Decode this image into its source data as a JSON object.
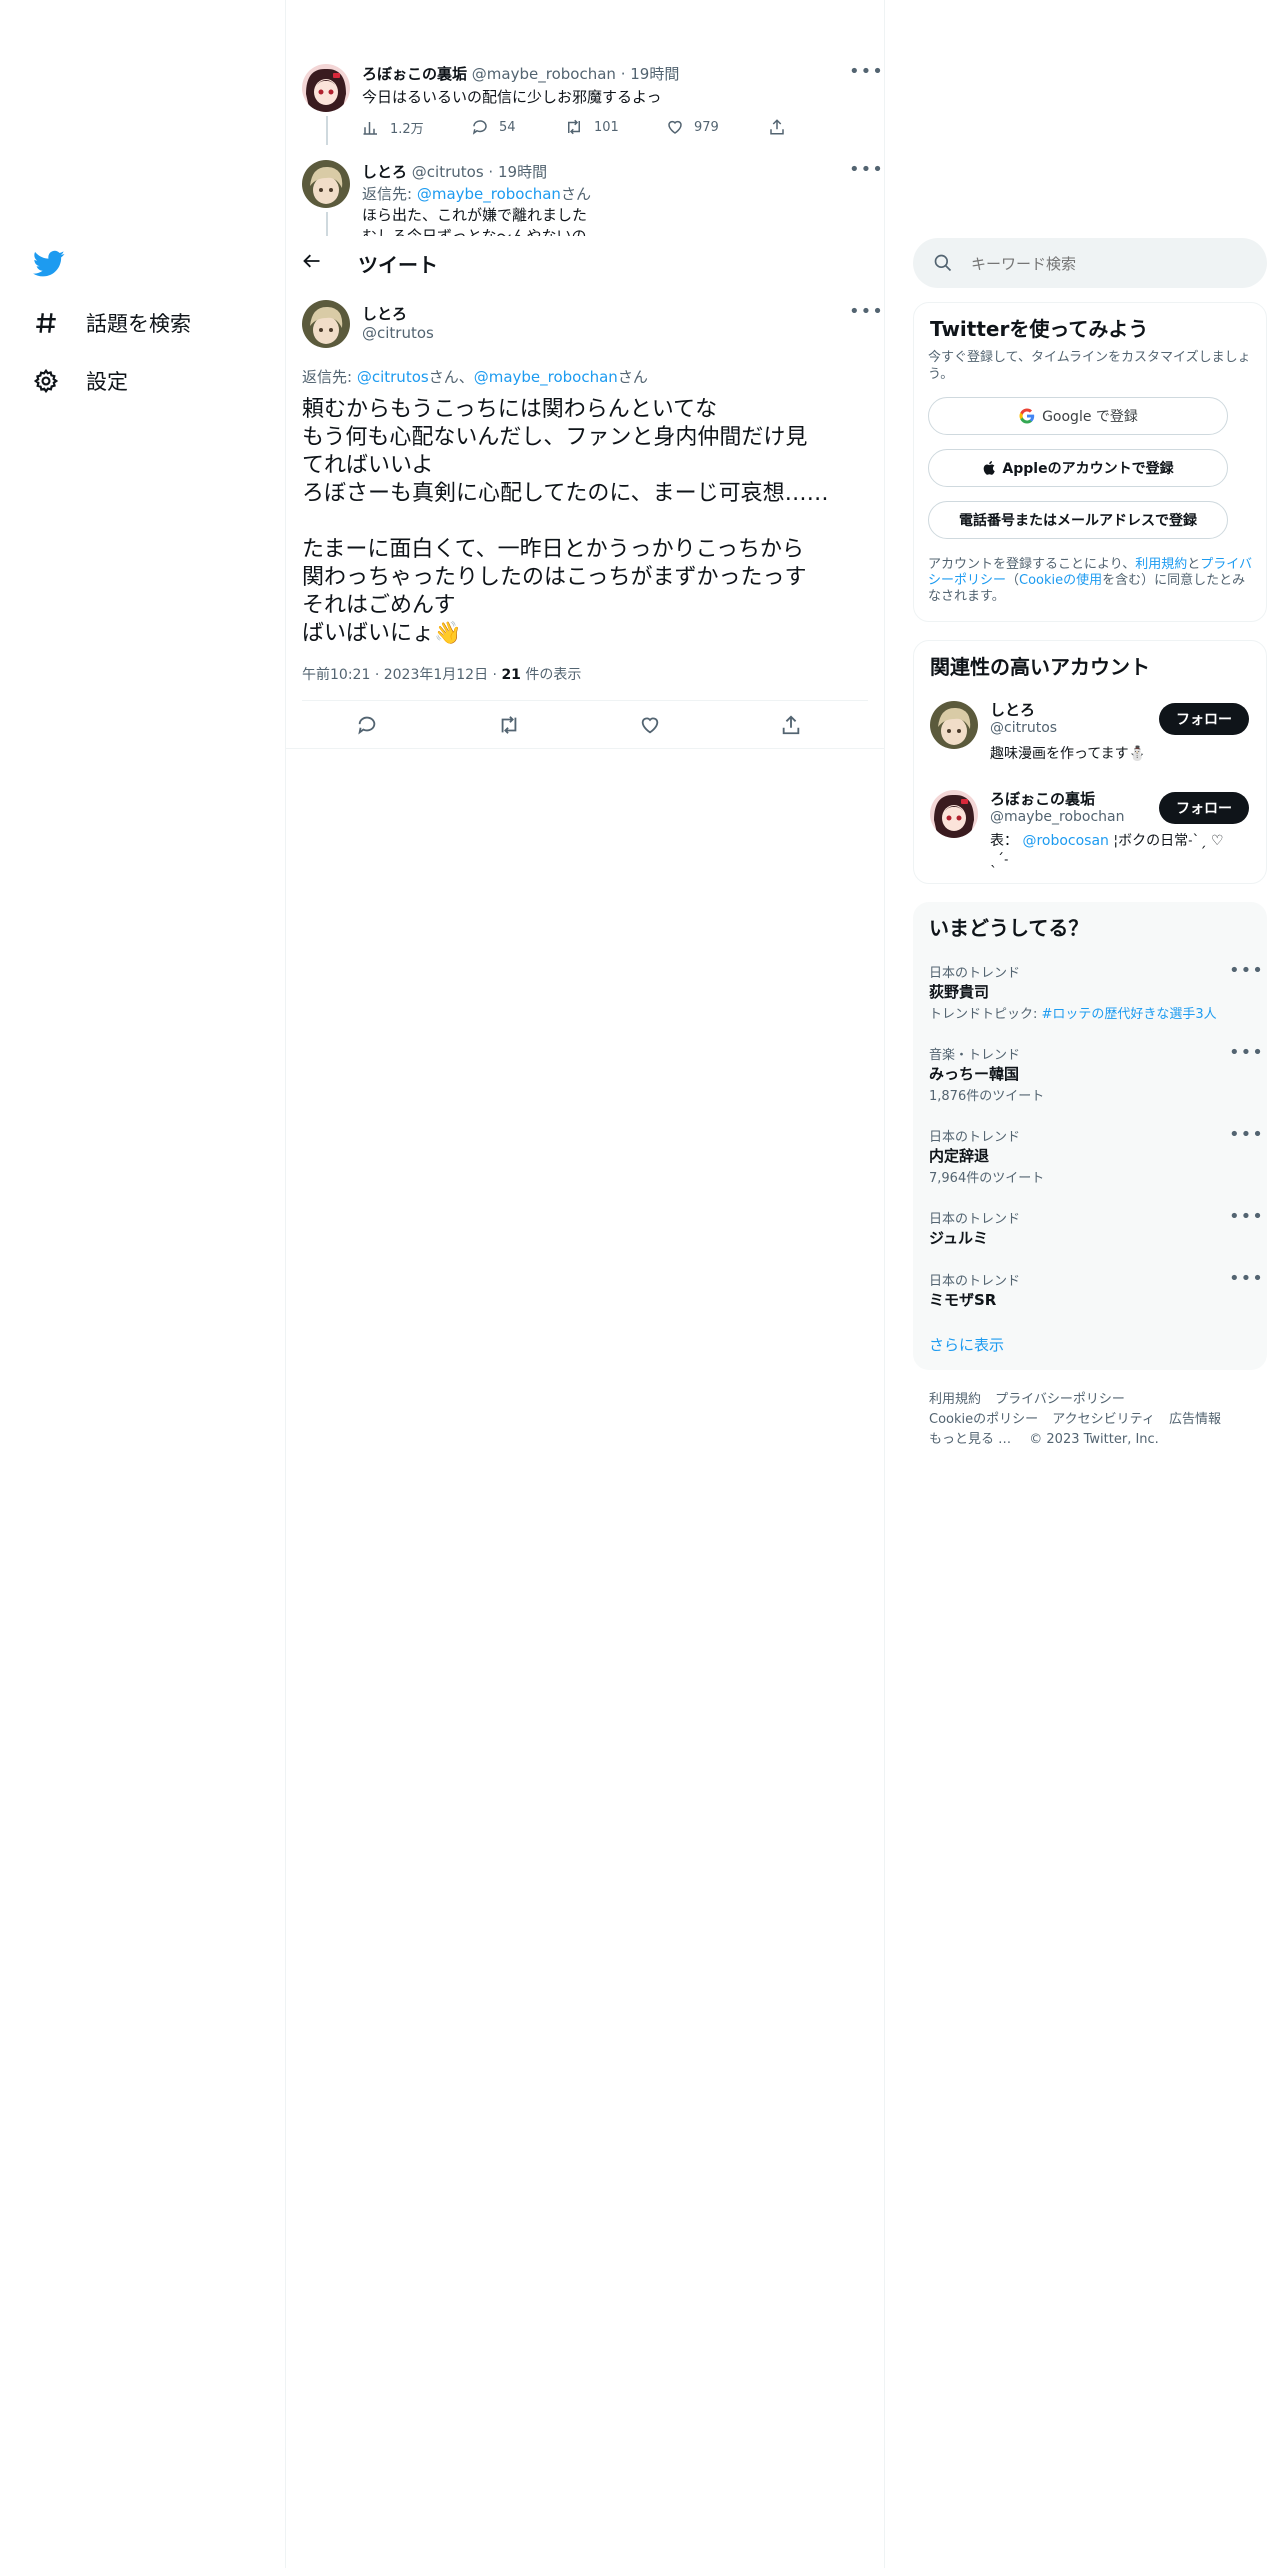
{
  "nav": {
    "items": [
      {
        "label": "話題を検索",
        "icon": "hashtag-icon"
      },
      {
        "label": "設定",
        "icon": "gear-icon"
      }
    ]
  },
  "thread": {
    "tweet1": {
      "name": "ろぼぉこの裏垢",
      "handle": "@maybe_robochan",
      "time": "19時間",
      "text": "今日はるいるいの配信に少しお邪魔するよっ",
      "views": "1.2万",
      "replies": "54",
      "retweets": "101",
      "likes": "979"
    },
    "tweet2": {
      "name": "しとろ",
      "handle": "@citrutos",
      "time": "19時間",
      "reply_prefix": "返信先:",
      "reply_to": "@maybe_robochan",
      "reply_suffix": "さん",
      "text_line1": "ほら出た、これが嫌で離れました",
      "text_line2": "むしろ今日ずっとな〜んやないの"
    }
  },
  "header": {
    "title": "ツイート"
  },
  "main_tweet": {
    "name": "しとろ",
    "handle": "@citrutos",
    "reply_prefix": "返信先:",
    "reply_to1": "@citrutos",
    "reply_mid": "さん、",
    "reply_to2": "@maybe_robochan",
    "reply_suffix": "さん",
    "lines": [
      "頼むからもうこっちには関わらんといてな",
      "もう何も心配ないんだし、ファンと身内仲間だけ見",
      "てればいいよ",
      "ろぼさーも真剣に心配してたのに、まーじ可哀想……",
      "",
      "たまーに面白くて、一昨日とかうっかりこっちから",
      "関わっちゃったりしたのはこっちがまずかったっす",
      "それはごめんす",
      "ばいばいにょ👋"
    ],
    "time": "午前10:21",
    "date": "2023年1月12日",
    "views_count": "21",
    "views_label": "件の表示"
  },
  "search": {
    "placeholder": "キーワード検索"
  },
  "signup": {
    "title": "Twitterを使ってみよう",
    "subtitle": "今すぐ登録して、タイムラインをカスタマイズしましょう。",
    "google": "Google で登録",
    "apple": "Appleのアカウントで登録",
    "phone": "電話番号またはメールアドレスで登録",
    "terms_pre": "アカウントを登録することにより、",
    "terms_link1": "利用規約",
    "terms_and": "と",
    "terms_link2": "プライバシーポリシー",
    "terms_paren1": "（",
    "terms_link3": "Cookieの使用",
    "terms_post": "を含む）に同意したとみなされます。"
  },
  "related": {
    "title": "関連性の高いアカウント",
    "follow_label": "フォロー",
    "accounts": [
      {
        "name": "しとろ",
        "handle": "@citrutos",
        "bio": "趣味漫画を作ってます⛄"
      },
      {
        "name": "ろぼぉこの裏垢",
        "handle": "@maybe_robochan",
        "bio_pre": "表：",
        "bio_link": "@robocosan",
        "bio_post": "¦ボクの日常˗ˋˏ ♡ ˎˊ˗"
      }
    ]
  },
  "trends": {
    "title": "いまどうしてる？",
    "items": [
      {
        "meta": "日本のトレンド",
        "name": "荻野貴司",
        "sub_pre": "トレンドトピック: ",
        "sub_link": "#ロッテの歴代好きな選手3人"
      },
      {
        "meta": "音楽・トレンド",
        "name": "みっちー韓国",
        "sub": "1,876件のツイート"
      },
      {
        "meta": "日本のトレンド",
        "name": "内定辞退",
        "sub": "7,964件のツイート"
      },
      {
        "meta": "日本のトレンド",
        "name": "ジュルミ"
      },
      {
        "meta": "日本のトレンド",
        "name": "ミモザSR"
      }
    ],
    "show_more": "さらに表示"
  },
  "footer": {
    "links": [
      "利用規約",
      "プライバシーポリシー",
      "Cookieのポリシー",
      "アクセシビリティ",
      "広告情報",
      "もっと見る …"
    ],
    "copyright": "© 2023 Twitter, Inc."
  },
  "colors": {
    "accent": "#1d9bf0",
    "text": "#0f1419",
    "muted": "#536471",
    "border": "#eff3f4",
    "panel": "#f7f9f9"
  }
}
